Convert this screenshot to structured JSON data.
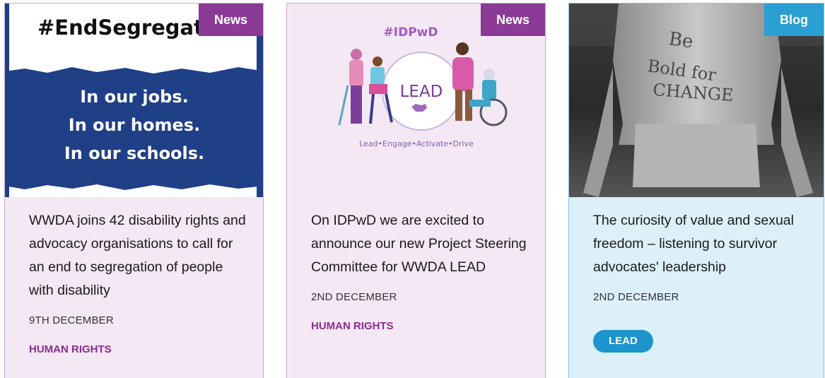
{
  "cards": [
    {
      "tag": "News",
      "image": {
        "hashtag": "#EndSegregat",
        "lines": [
          "In our jobs.",
          "In our homes.",
          "In our schools."
        ]
      },
      "headline": "WWDA joins 42 disability rights and advocacy organisations to call for an end to segregation of people with disability",
      "date": "9TH DECEMBER",
      "category": "HUMAN RIGHTS"
    },
    {
      "tag": "News",
      "image": {
        "hashtag": "#IDPwD",
        "logo": "LEAD",
        "tagline": "Lead•Engage•Activate•Drive"
      },
      "headline": "On IDPwD we are excited to announce our new Project Steering Committee for WWDA LEAD",
      "date": "2ND DECEMBER",
      "category": "HUMAN RIGHTS"
    },
    {
      "tag": "Blog",
      "image": {
        "body_writing": [
          "Be",
          "Bold for",
          "CHANGE"
        ]
      },
      "headline": "The curiosity of value and sexual freedom – listening to survivor advocates' leadership",
      "date": "2ND DECEMBER",
      "category": "LEAD"
    }
  ],
  "colors": {
    "news_tag": "#8b3a96",
    "blog_tag": "#2a9fd2",
    "card_pink": "#f4e8f4",
    "card_blue": "#dcf0fa",
    "poster_blue": "#1f3f87"
  }
}
